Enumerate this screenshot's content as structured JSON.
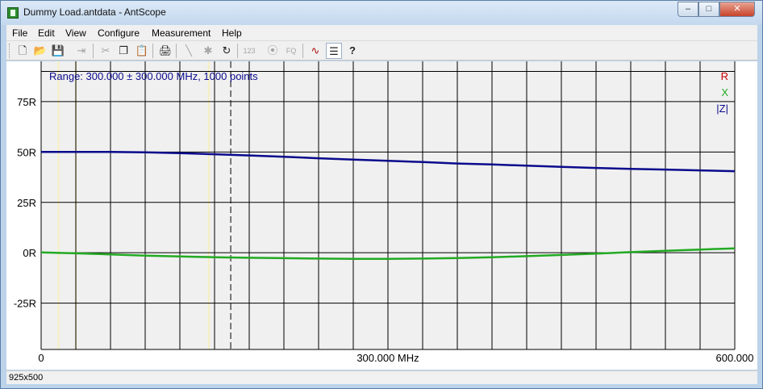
{
  "window": {
    "title": "Dummy Load.antdata - AntScope",
    "min_glyph": "–",
    "max_glyph": "□",
    "close_glyph": "✕"
  },
  "menu": [
    "File",
    "Edit",
    "View",
    "Configure",
    "Measurement",
    "Help"
  ],
  "toolbar": {
    "fq_label": "FQ",
    "num_label": "123",
    "buttons": [
      {
        "icon": "new-file-icon",
        "glyph": "🗋",
        "enabled": true
      },
      {
        "icon": "open-folder-icon",
        "glyph": "📂",
        "enabled": true
      },
      {
        "icon": "save-icon",
        "glyph": "💾",
        "enabled": true
      },
      {
        "icon": "export-icon",
        "glyph": "⇥",
        "enabled": false
      },
      {
        "icon": "cut-icon",
        "glyph": "✂",
        "enabled": false
      },
      {
        "icon": "copy-icon",
        "glyph": "❐",
        "enabled": true
      },
      {
        "icon": "paste-icon",
        "glyph": "📋",
        "enabled": false
      },
      {
        "icon": "print-icon",
        "glyph": "🖨",
        "enabled": true
      },
      {
        "icon": "single-scan-icon",
        "glyph": "╲",
        "enabled": false
      },
      {
        "icon": "star-icon",
        "glyph": "✱",
        "enabled": false
      },
      {
        "icon": "refresh-icon",
        "glyph": "↻",
        "enabled": true
      },
      {
        "icon": "numeric-icon",
        "glyph": "",
        "enabled": false
      },
      {
        "icon": "antenna-icon",
        "glyph": "⦿",
        "enabled": false
      },
      {
        "icon": "fq-icon",
        "glyph": "",
        "enabled": false
      },
      {
        "icon": "graph-icon",
        "glyph": "∿",
        "enabled": true
      },
      {
        "icon": "settings-icon",
        "glyph": "☰",
        "enabled": true
      },
      {
        "icon": "help-icon",
        "glyph": "?",
        "enabled": true
      }
    ]
  },
  "chart_data": {
    "type": "line",
    "title": "Range: 300.000 ± 300.000 MHz, 1000 points",
    "xlabel": "",
    "ylabel": "",
    "x_ticks": [
      "0",
      "300.000 MHz",
      "600.000"
    ],
    "y_ticks": [
      "75R",
      "50R",
      "25R",
      "0R",
      "-25R"
    ],
    "xlim": [
      0,
      600
    ],
    "ylim": [
      -48,
      95
    ],
    "grid": true,
    "legend_placement": "top-right",
    "series": [
      {
        "name": "R",
        "color": "#cc0000",
        "x": [],
        "y": []
      },
      {
        "name": "X",
        "color": "#22aa22",
        "x": [
          0,
          30,
          60,
          90,
          120,
          150,
          180,
          210,
          240,
          270,
          300,
          330,
          360,
          390,
          420,
          450,
          480,
          510,
          540,
          570,
          600
        ],
        "y": [
          0.2,
          -0.3,
          -0.8,
          -1.4,
          -1.8,
          -2.2,
          -2.5,
          -2.7,
          -2.9,
          -3.0,
          -3.0,
          -2.9,
          -2.6,
          -2.2,
          -1.7,
          -1.1,
          -0.4,
          0.3,
          1.0,
          1.6,
          2.2
        ]
      },
      {
        "name": "|Z|",
        "color": "#0a0a8c",
        "x": [
          0,
          30,
          60,
          90,
          120,
          150,
          180,
          210,
          240,
          270,
          300,
          330,
          360,
          390,
          420,
          450,
          480,
          510,
          540,
          570,
          600
        ],
        "y": [
          50.0,
          50.0,
          50.0,
          49.8,
          49.4,
          48.9,
          48.3,
          47.6,
          46.9,
          46.2,
          45.6,
          45.0,
          44.3,
          43.8,
          43.2,
          42.6,
          42.1,
          41.6,
          41.3,
          40.9,
          40.5
        ]
      }
    ],
    "markers": {
      "faint_x": [
        15,
        30,
        145
      ],
      "dashed_x": [
        164
      ]
    }
  },
  "status": {
    "text": "925x500"
  }
}
